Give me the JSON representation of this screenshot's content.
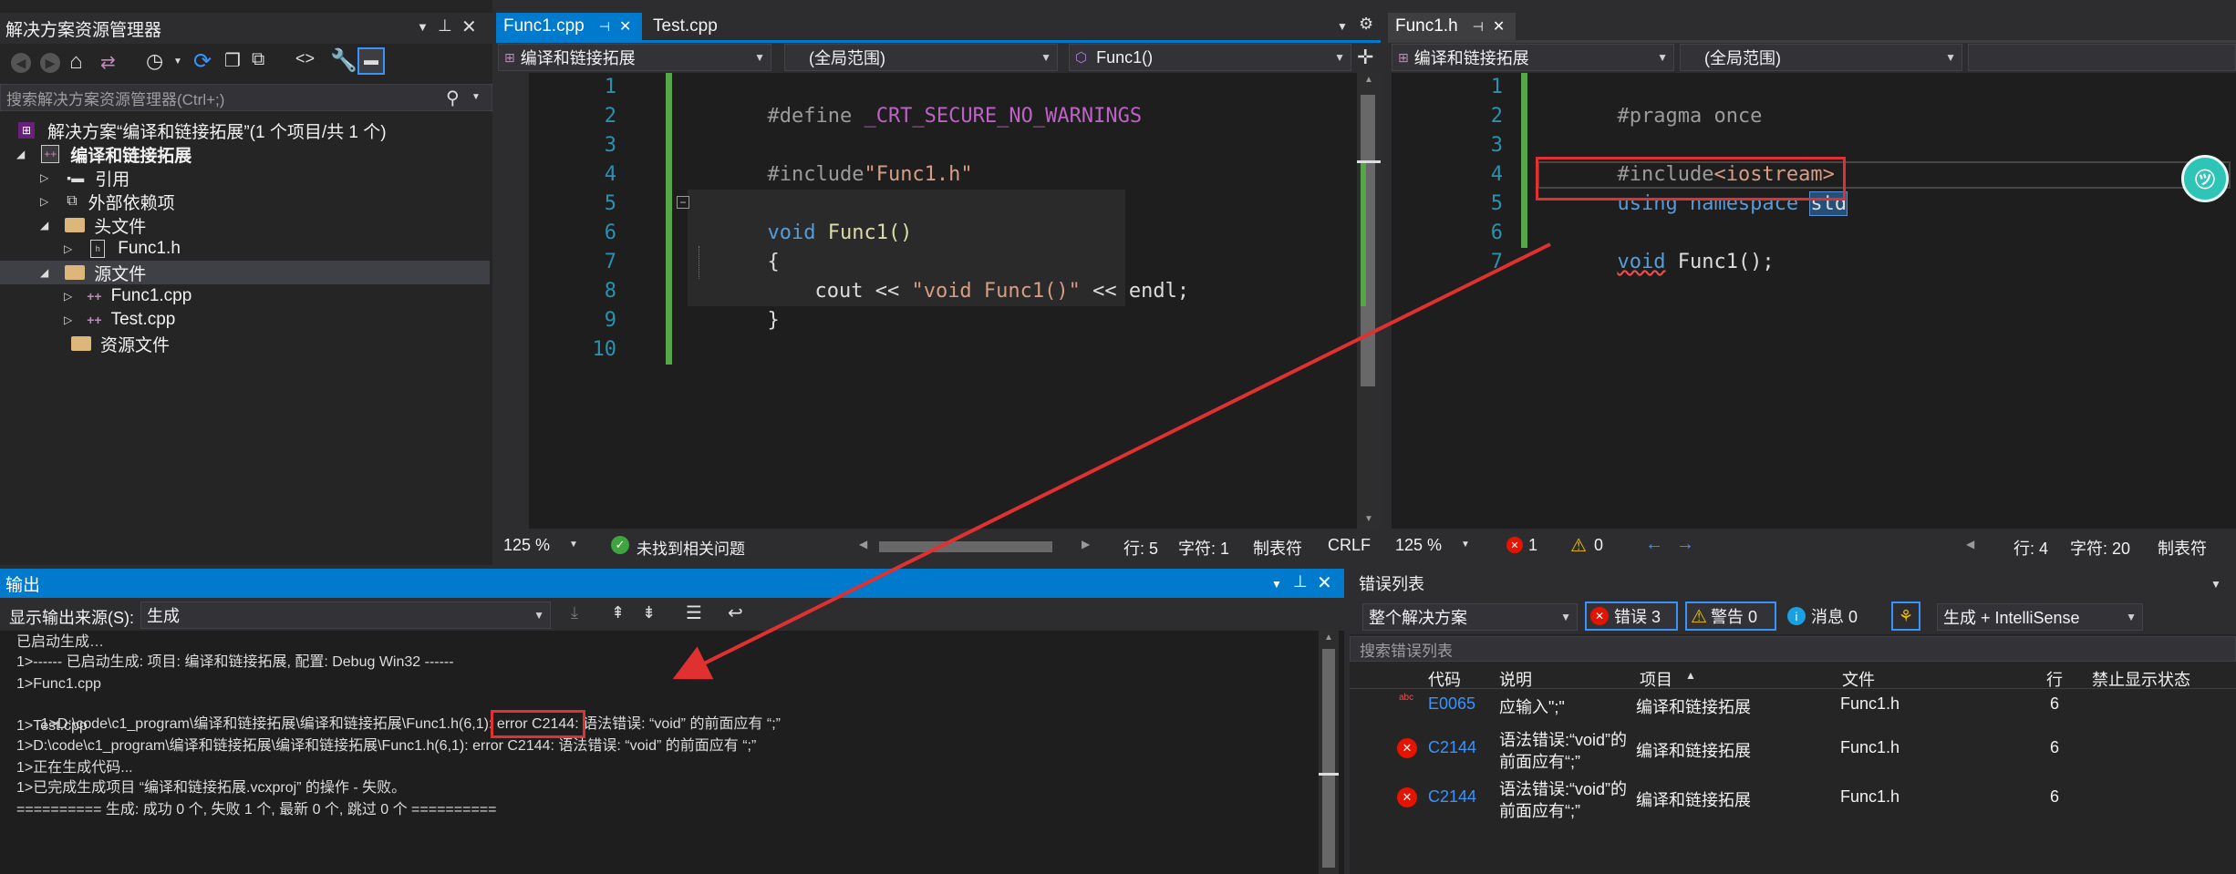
{
  "solution_explorer": {
    "title": "解决方案资源管理器",
    "search_placeholder": "搜索解决方案资源管理器(Ctrl+;)",
    "solution_label": "解决方案“编译和链接拓展”(1 个项目/共 1 个)",
    "project_label": "编译和链接拓展",
    "items": {
      "references": "引用",
      "external_deps": "外部依赖项",
      "header_files": "头文件",
      "func1_h": "Func1.h",
      "source_files": "源文件",
      "func1_cpp": "Func1.cpp",
      "test_cpp": "Test.cpp",
      "resource_files": "资源文件"
    }
  },
  "left_editor": {
    "tabs": {
      "tab1": "Func1.cpp",
      "tab2": "Test.cpp"
    },
    "project_dropdown": "编译和链接拓展",
    "scope_dropdown": "(全局范围)",
    "member_dropdown": "Func1()",
    "line_numbers": [
      "1",
      "2",
      "3",
      "4",
      "5",
      "6",
      "7",
      "8",
      "9",
      "10"
    ],
    "code": {
      "l1_kw": "#define",
      "l1_rest": " _CRT_SECURE_NO_WARNINGS",
      "l3_kw": "#include",
      "l3_str": "\"Func1.h\"",
      "l5_kw": "void",
      "l5_fn": " Func1()",
      "l6": "{",
      "l7_a": "cout << ",
      "l7_str": "\"void Func1()\"",
      "l7_b": " << endl;",
      "l8": "}"
    },
    "status": {
      "zoom": "125 %",
      "issues": "未找到相关问题",
      "row": "行: 5",
      "char": "字符: 1",
      "tabs": "制表符",
      "eol": "CRLF"
    }
  },
  "right_editor": {
    "tabs": {
      "tab1": "Func1.h"
    },
    "project_dropdown": "编译和链接拓展",
    "scope_dropdown": "(全局范围)",
    "line_numbers": [
      "1",
      "2",
      "3",
      "4",
      "5",
      "6",
      "7"
    ],
    "code": {
      "l1": "#pragma once",
      "l3_kw": "#include",
      "l3_inc": "<iostream>",
      "l4_kw": "using namespace ",
      "l4_ns": "std",
      "l6_kw": "void",
      "l6_rest": " Func1();"
    },
    "status": {
      "zoom": "125 %",
      "errors": "1",
      "warnings": "0",
      "row": "行: 4",
      "char": "字符: 20",
      "tabs": "制表符"
    }
  },
  "output_panel": {
    "title": "输出",
    "source_label": "显示输出来源(S):",
    "source_value": "生成",
    "lines": [
      "已启动生成…",
      "1>------ 已启动生成: 项目: 编译和链接拓展, 配置: Debug Win32 ------",
      "1>Func1.cpp",
      "1>D:\\code\\c1_program\\编译和链接拓展\\编译和链接拓展\\Func1.h(6,1): ",
      "error C2144:",
      " 语法错误: “void” 的前面应有 “;”",
      "1>Test.cpp",
      "1>D:\\code\\c1_program\\编译和链接拓展\\编译和链接拓展\\Func1.h(6,1): error C2144: 语法错误: “void” 的前面应有 “;”",
      "1>正在生成代码...",
      "1>已完成生成项目 “编译和链接拓展.vcxproj” 的操作 - 失败。",
      "========== 生成: 成功 0 个, 失败 1 个, 最新 0 个, 跳过 0 个 =========="
    ]
  },
  "error_list": {
    "title": "错误列表",
    "scope": "整个解决方案",
    "errors_btn": "错误 3",
    "warnings_btn": "警告 0",
    "messages_btn": "消息 0",
    "source_filter": "生成 + IntelliSense",
    "search_placeholder": "搜索错误列表",
    "columns": {
      "code": "代码",
      "desc": "说明",
      "project": "项目",
      "file": "文件",
      "line": "行",
      "suppress": "禁止显示状态"
    },
    "rows": [
      {
        "code": "E0065",
        "desc1": "应输入\";\"",
        "desc2": "",
        "project": "编译和链接拓展",
        "file": "Func1.h",
        "line": "6"
      },
      {
        "code": "C2144",
        "desc1": "语法错误:“void”的",
        "desc2": "前面应有“;”",
        "project": "编译和链接拓展",
        "file": "Func1.h",
        "line": "6"
      },
      {
        "code": "C2144",
        "desc1": "语法错误:“void”的",
        "desc2": "前面应有“;”",
        "project": "编译和链接拓展",
        "file": "Func1.h",
        "line": "6"
      }
    ]
  },
  "colors": {
    "keyword": "#569cd6",
    "string": "#d69d85",
    "function": "#dcdcaa",
    "line_number": "#2b91af",
    "annotation_red": "#e03131",
    "accent_blue": "#007acc"
  }
}
